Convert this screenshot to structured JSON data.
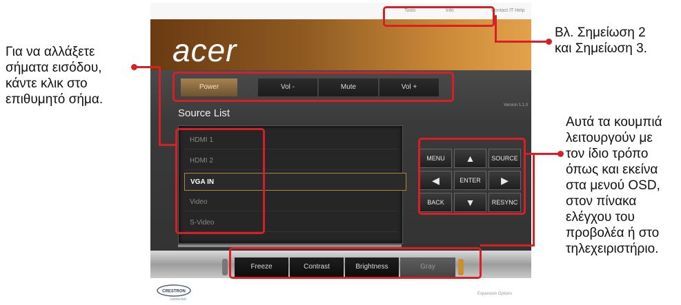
{
  "callouts": {
    "left": [
      "Για να αλλάξετε",
      "σήματα εισόδου,",
      "κάντε κλικ στο",
      "επιθυμητό σήμα."
    ],
    "top_right": [
      "Βλ. Σημείωση 2",
      "και Σημείωση 3."
    ],
    "right": [
      "Αυτά τα κουμπιά",
      "λειτουργούν με",
      "τον ίδιο τρόπο",
      "όπως και εκείνα",
      "στα μενού OSD,",
      "στον πίνακα",
      "ελέγχου του",
      "προβολέα ή στο",
      "τηλεχειριστήριο."
    ]
  },
  "header": {
    "links": [
      "Tools",
      "Info",
      "Contact IT Help"
    ],
    "logo": "acer"
  },
  "top_buttons": [
    "Power",
    "Vol -",
    "Mute",
    "Vol +"
  ],
  "version_text": "Version 1.1.0",
  "source_list": {
    "title": "Source List",
    "items": [
      "HDMI 1",
      "HDMI 2",
      "VGA IN",
      "Video",
      "S-Video"
    ],
    "selected": "VGA IN"
  },
  "keypad": {
    "row1": [
      "MENU",
      "▲",
      "SOURCE"
    ],
    "row2": [
      "◀",
      "ENTER",
      "▶"
    ],
    "row3": [
      "BACK",
      "▼",
      "RESYNC"
    ]
  },
  "bottom_buttons": [
    "Freeze",
    "Contrast",
    "Brightness",
    "Gray"
  ],
  "footer": {
    "brand": "CRESTRON",
    "brand_sub": "connected",
    "right_text": "Expansion Options"
  },
  "colors": {
    "highlight": "#d91f26",
    "banner": "#cf8d3a",
    "panel_dark": "#3a3a3a"
  }
}
